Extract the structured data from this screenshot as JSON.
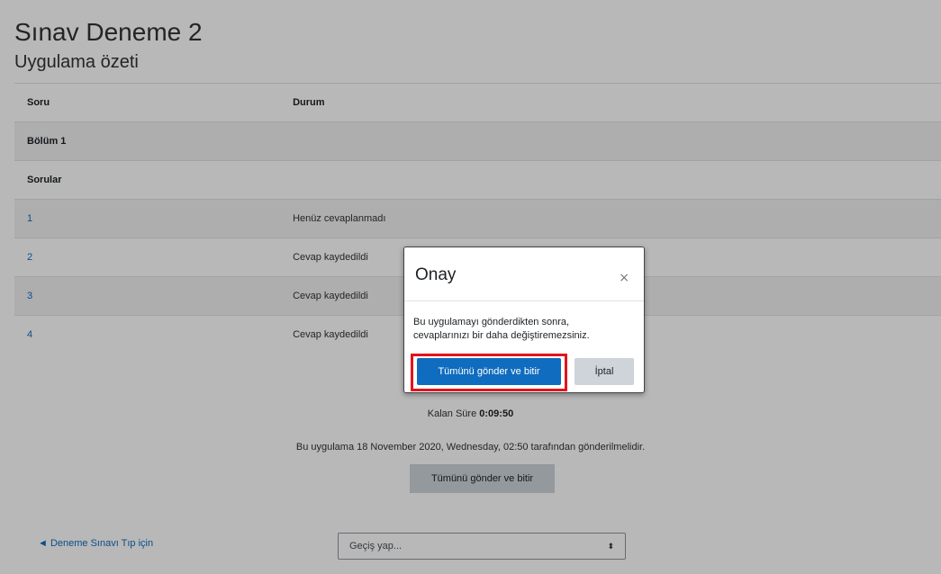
{
  "page": {
    "title": "Sınav Deneme 2",
    "subtitle": "Uygulama özeti"
  },
  "table": {
    "headers": [
      "Soru",
      "Durum"
    ],
    "section_label": "Bölüm 1",
    "group_label": "Sorular",
    "rows": [
      {
        "num": "1",
        "status": "Henüz cevaplanmadı"
      },
      {
        "num": "2",
        "status": "Cevap kaydedildi"
      },
      {
        "num": "3",
        "status": "Cevap kaydedildi"
      },
      {
        "num": "4",
        "status": "Cevap kaydedildi"
      }
    ]
  },
  "timer": {
    "label": "Kalan Süre",
    "value": "0:09:50"
  },
  "deadline_text": "Bu uygulama 18 November 2020, Wednesday, 02:50 tarafından gönderilmelidir.",
  "submit_all_label": "Tümünü gönder ve bitir",
  "nav": {
    "back_link": "◄ Deneme Sınavı Tıp için",
    "jump_placeholder": "Geçiş yap...",
    "jump_arrows": "⬍"
  },
  "modal": {
    "title": "Onay",
    "close_glyph": "×",
    "body_line1": "Bu uygulamayı gönderdikten sonra,",
    "body_line2": "cevaplarınızı bir daha değiştiremezsiniz.",
    "confirm_label": "Tümünü gönder ve bitir",
    "cancel_label": "İptal"
  },
  "colors": {
    "primary": "#0f6cbf",
    "highlight": "#e5131b",
    "secondary_button": "#ced4da"
  }
}
